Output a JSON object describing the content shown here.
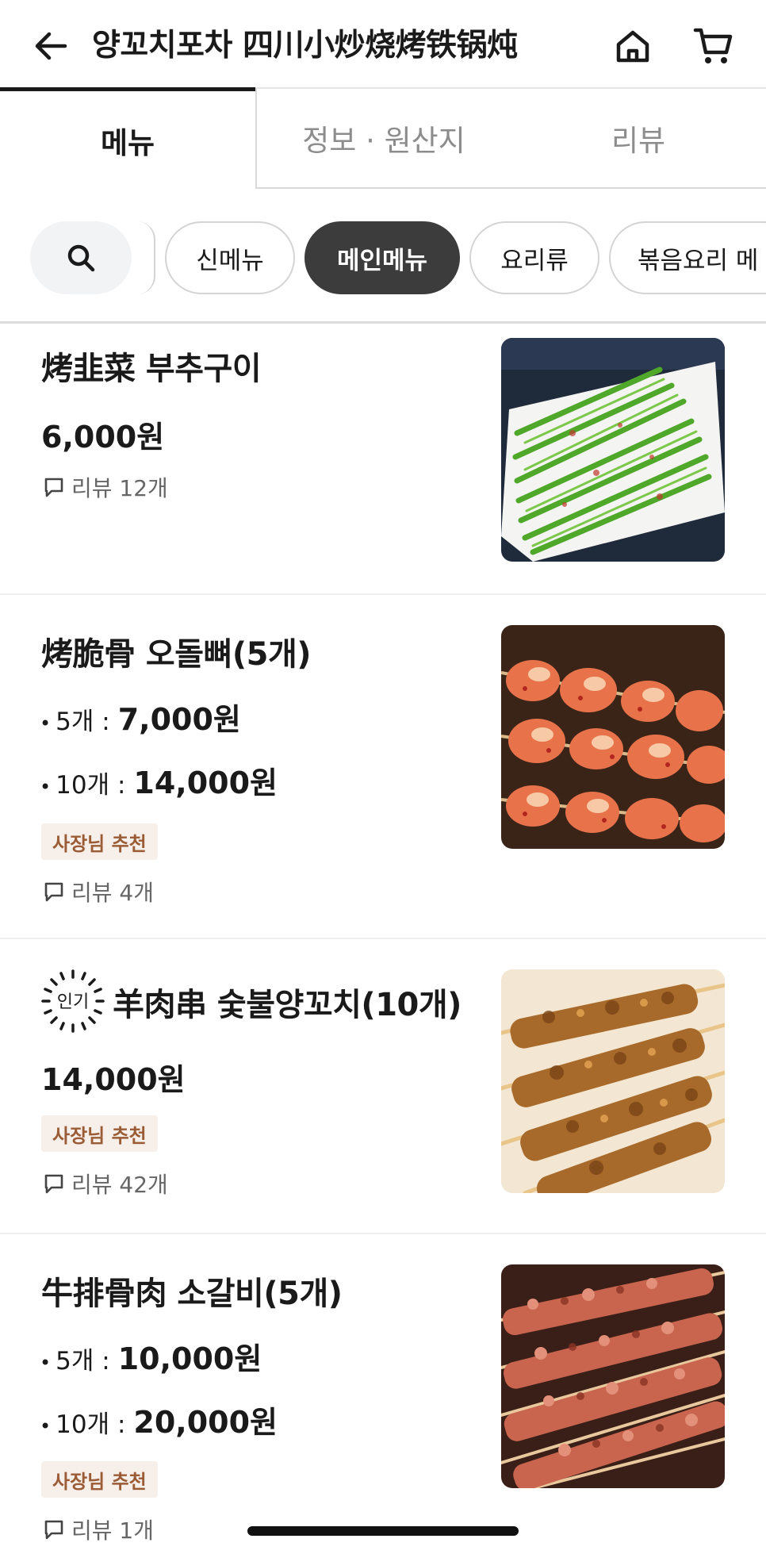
{
  "header": {
    "title": "양꼬치포차 四川小炒烧烤铁锅炖"
  },
  "tabs": [
    {
      "label": "메뉴"
    },
    {
      "label": "정보 · 원산지"
    },
    {
      "label": "리뷰"
    }
  ],
  "chips": [
    {
      "label": "신메뉴"
    },
    {
      "label": "메인메뉴"
    },
    {
      "label": "요리류"
    },
    {
      "label": "볶음요리 메"
    }
  ],
  "items": [
    {
      "name": "烤韭菜 부추구이",
      "price": "6,000원",
      "review": "리뷰 12개"
    },
    {
      "name": "烤脆骨 오돌뼈(5개)",
      "options": [
        {
          "label": "5개 :",
          "price": "7,000원"
        },
        {
          "label": "10개 :",
          "price": "14,000원"
        }
      ],
      "badge": "사장님 추천",
      "review": "리뷰 4개"
    },
    {
      "popular": "인기",
      "name": "羊肉串 숯불양꼬치(10개)",
      "price": "14,000원",
      "badge": "사장님 추천",
      "review": "리뷰 42개"
    },
    {
      "name": "牛排骨肉 소갈비(5개)",
      "options": [
        {
          "label": "5개 :",
          "price": "10,000원"
        },
        {
          "label": "10개 :",
          "price": "20,000원"
        }
      ],
      "badge": "사장님 추천",
      "review": "리뷰 1개"
    }
  ],
  "colors": {
    "active_chip": "#3c3c3c",
    "badge_bg": "#f7efe9",
    "badge_text": "#9a5b35"
  }
}
